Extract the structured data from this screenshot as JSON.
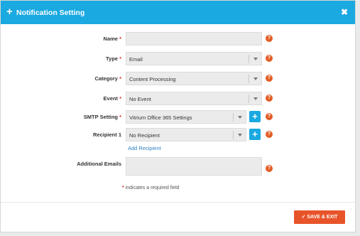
{
  "dialog": {
    "title": "Notification Setting",
    "title_icon": "plus-icon",
    "close_icon": "close-icon",
    "header_color": "#1aa9e1"
  },
  "fields": {
    "name": {
      "label": "Name",
      "required_mark": "*",
      "value": ""
    },
    "type": {
      "label": "Type",
      "required_mark": "*",
      "value": "Email"
    },
    "category": {
      "label": "Category",
      "required_mark": "*",
      "value": "Content Processing"
    },
    "event": {
      "label": "Event",
      "required_mark": "*",
      "value": "No Event"
    },
    "smtp": {
      "label": "SMTP Setting",
      "required_mark": "*",
      "value": "Vitrium Office 365 Settings"
    },
    "recipient": {
      "label": "Recipient 1",
      "value": "No Recipient",
      "add_link": "Add Recipient"
    },
    "additional_emails": {
      "label": "Additional Emails",
      "value": ""
    }
  },
  "help_icon": {
    "glyph": "?",
    "color": "#e35e27"
  },
  "add_button": {
    "glyph": "+"
  },
  "required_note": {
    "mark": "*",
    "text": " indicates a required field"
  },
  "footer": {
    "save_label": "✓ SAVE & EXIT",
    "save_color": "#e8542a"
  }
}
